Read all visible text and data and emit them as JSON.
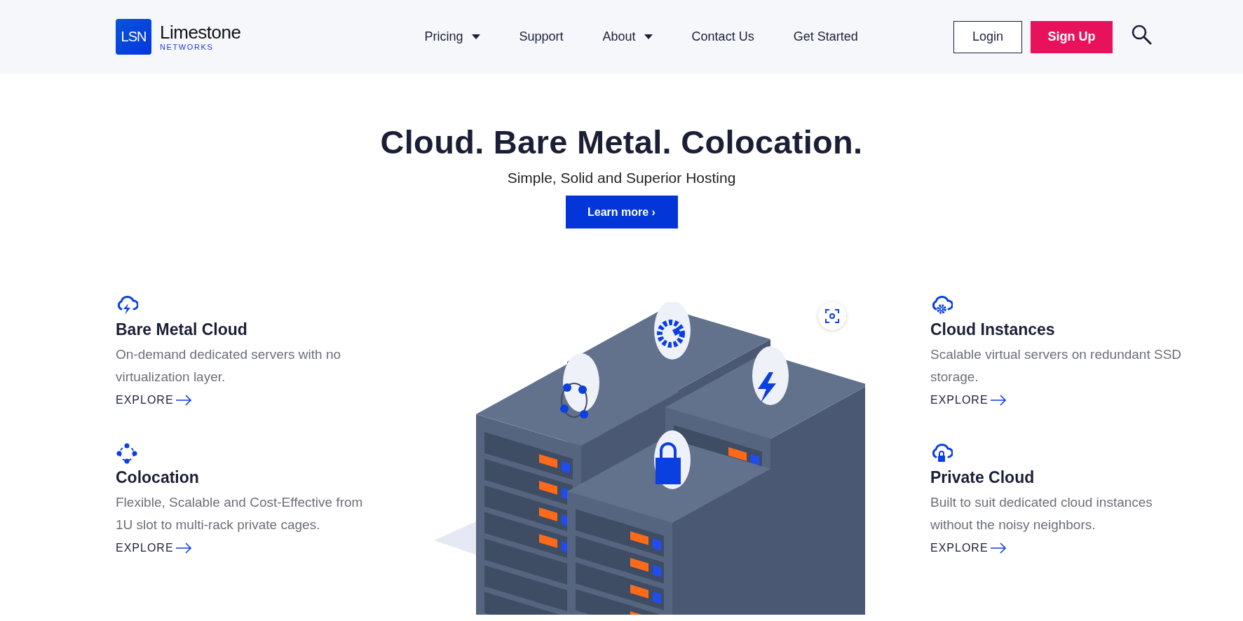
{
  "logo": {
    "mark": "LSN",
    "name": "Limestone",
    "tagline": "NETWORKS"
  },
  "nav": [
    {
      "label": "Pricing",
      "dropdown": true
    },
    {
      "label": "Support",
      "dropdown": false
    },
    {
      "label": "About",
      "dropdown": true
    },
    {
      "label": "Contact Us",
      "dropdown": false
    },
    {
      "label": "Get Started",
      "dropdown": false
    }
  ],
  "auth": {
    "login": "Login",
    "signup": "Sign Up"
  },
  "hero": {
    "title": "Cloud. Bare Metal. Colocation.",
    "subtitle": "Simple, Solid and Superior Hosting",
    "button": "Learn more ›"
  },
  "left_features": [
    {
      "kind": "cloud-bolt",
      "title": "Bare Metal Cloud",
      "description": "On-demand dedicated servers with no virtualization layer.",
      "link": "EXPLORE"
    },
    {
      "kind": "dot-ring",
      "title": "Colocation",
      "description": "Flexible, Scalable and Cost-Effective from 1U slot to multi-rack private cages.",
      "link": "EXPLORE"
    }
  ],
  "right_features": [
    {
      "kind": "cloud-gear",
      "title": "Cloud Instances",
      "description": "Scalable virtual servers on redundant SSD storage.",
      "link": "EXPLORE"
    },
    {
      "kind": "cloud-lock",
      "title": "Private Cloud",
      "description": "Built to suit dedicated cloud instances without the noisy neighbors.",
      "link": "EXPLORE"
    }
  ]
}
